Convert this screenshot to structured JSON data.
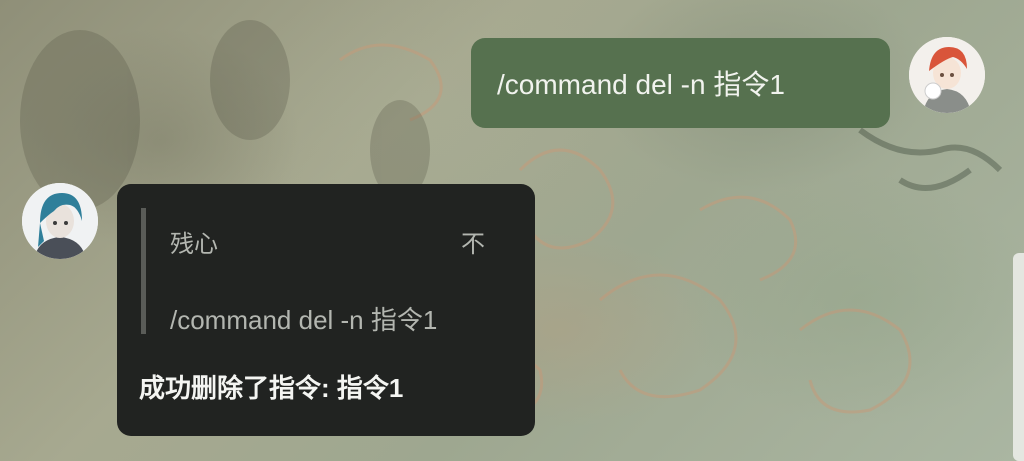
{
  "chat": {
    "sent_message": {
      "text": "/command del -n 指令1",
      "bubble_color": "#56714f"
    },
    "bot_reply": {
      "quote": {
        "author": "残心",
        "tag": "不",
        "text": "/command del -n 指令1"
      },
      "text": "成功删除了指令: 指令1",
      "bubble_color": "#212321"
    },
    "avatars": {
      "self": "anime-avatar-red-hair",
      "bot": "anime-avatar-blue-hair"
    }
  }
}
